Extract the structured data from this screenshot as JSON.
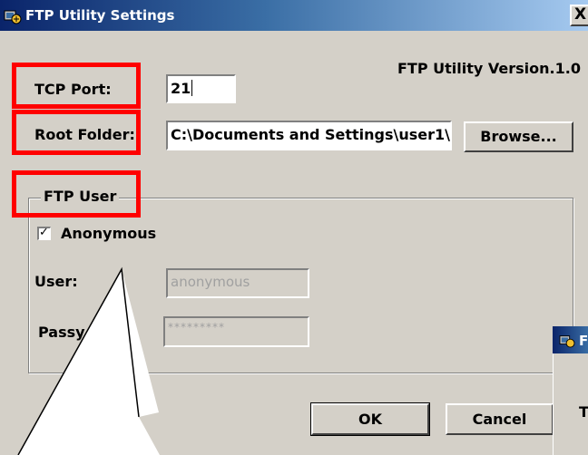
{
  "window": {
    "title": "FTP Utility Settings",
    "close_glyph": "X",
    "version": "FTP Utility Version.1.0"
  },
  "fields": {
    "tcp_port_label": "TCP Port:",
    "tcp_port_value": "21",
    "root_folder_label": "Root Folder:",
    "root_folder_value": "C:\\Documents and Settings\\user1\\",
    "browse_label": "Browse..."
  },
  "ftp_user": {
    "group_label": "FTP User",
    "anonymous_label": "Anonymous",
    "anonymous_checked": true,
    "user_label": "User:",
    "user_value": "anonymous",
    "password_label": "Passy",
    "password_value": "*********"
  },
  "buttons": {
    "ok_label": "OK",
    "cancel_label": "Cancel"
  },
  "second_window": {
    "title": "F",
    "label": "T"
  },
  "icons": {
    "title_icon": "ftp-app-icon",
    "check_icon": "checkmark-icon"
  },
  "colors": {
    "highlight": "#ff0000",
    "titlebar_start": "#0a246a",
    "titlebar_end": "#a6caf0",
    "dialog_bg": "#d4d0c8"
  }
}
